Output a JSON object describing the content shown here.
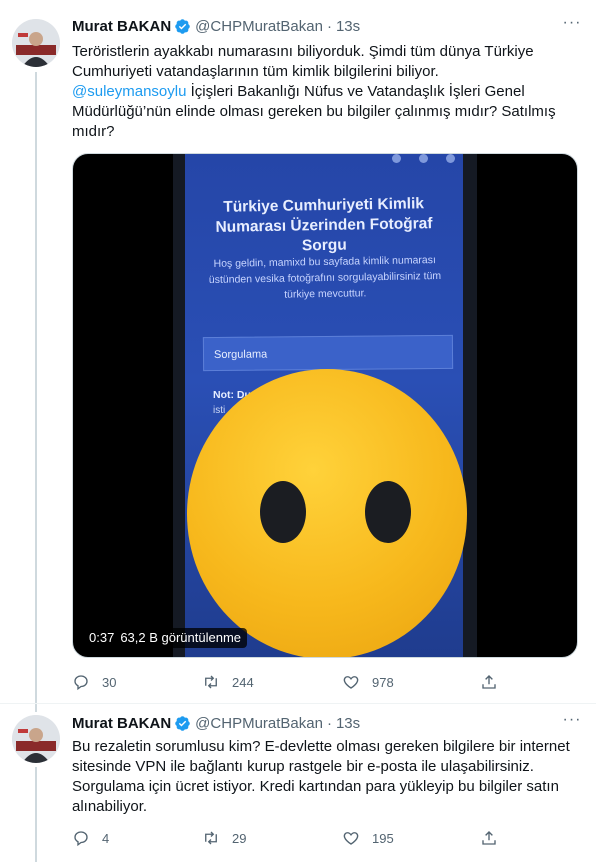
{
  "tweets": [
    {
      "author_name": "Murat BAKAN",
      "handle": "@CHPMuratBakan",
      "separator": "·",
      "time": "13s",
      "text_line1": "Teröristlerin ayakkabı numarasını biliyorduk. Şimdi tüm dünya Türkiye",
      "text_line2": "Cumhuriyeti vatandaşlarının tüm kimlik bilgilerini biliyor.",
      "mention": "@suleymansoylu",
      "text_line3_rest": " İçişleri Bakanlığı Nüfus ve Vatandaşlık İşleri Genel",
      "text_line4": "Müdürlüğü’nün elinde olması gereken bu bilgiler çalınmış mıdır? Satılmış",
      "text_line5": "mıdır?",
      "video": {
        "screen_title": "Türkiye Cumhuriyeti Kimlik Numarası Üzerinden Fotoğraf Sorgu",
        "screen_subtitle": "Hoş geldin, mamixd bu sayfada kimlik numarası üstünden vesika fotoğrafını sorgulayabilirsiniz tüm türkiye mevcuttur.",
        "screen_box_label": "Sorgulama",
        "screen_note": "Not: Du",
        "screen_note2": "isti",
        "duration": "0:37",
        "views": "63,2 B görüntülenme"
      },
      "replies": "30",
      "retweets": "244",
      "likes": "978"
    },
    {
      "author_name": "Murat BAKAN",
      "handle": "@CHPMuratBakan",
      "separator": "·",
      "time": "13s",
      "text_line1": "Bu rezaletin sorumlusu kim? E-devlette olması gereken bilgilere bir internet",
      "text_line2": "sitesinde VPN ile bağlantı kurup rastgele bir e-posta ile ulaşabilirsiniz.",
      "text_line3": "Sorgulama için ücret istiyor. Kredi kartından para yükleyip bu bilgiler satın",
      "text_line4": "alınabiliyor.",
      "replies": "4",
      "retweets": "29",
      "likes": "195"
    }
  ],
  "icons": [
    "verified-badge-icon",
    "more-icon",
    "reply-icon",
    "retweet-icon",
    "like-icon",
    "share-icon"
  ],
  "colors": {
    "accent": "#1d9bf0",
    "secondary_text": "#536471",
    "emoji_yellow": "#f7b81c"
  }
}
